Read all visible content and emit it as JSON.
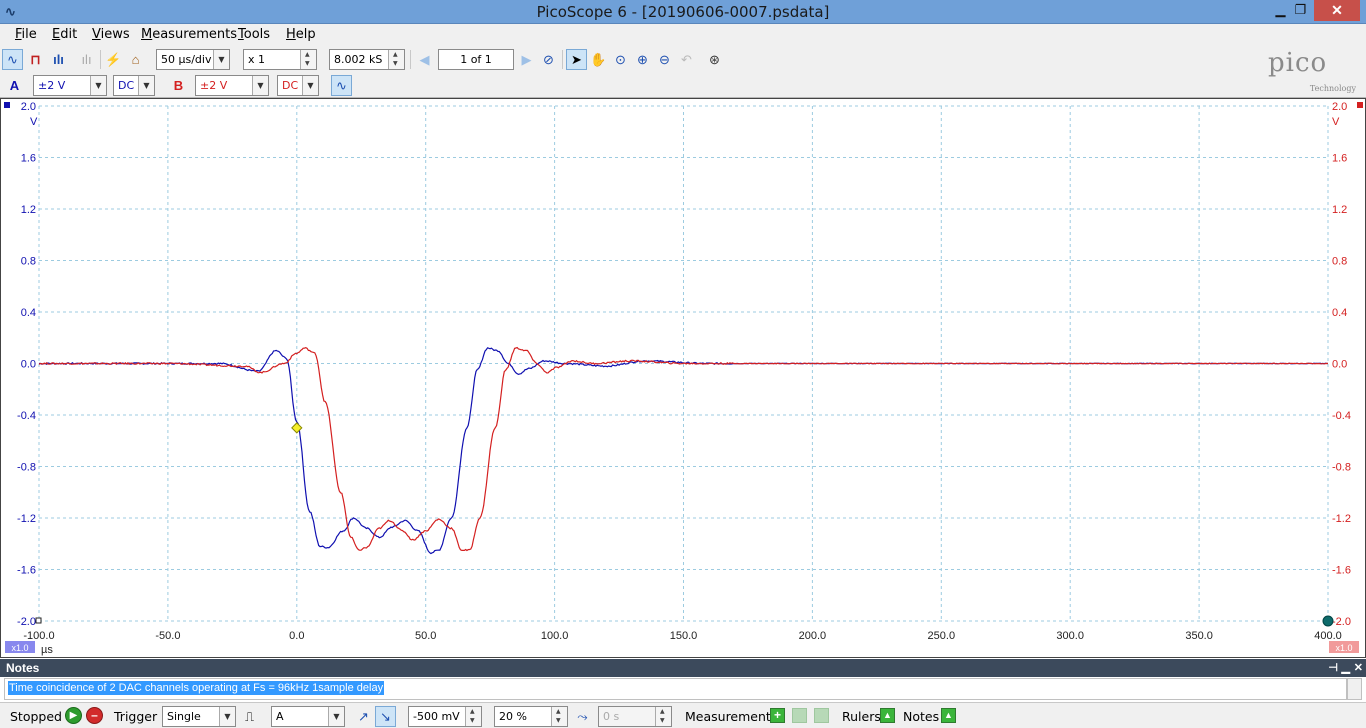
{
  "window": {
    "title": "PicoScope 6 - [20190606-0007.psdata]",
    "minimize": "▁",
    "restore": "❐",
    "close": "✕"
  },
  "menu": [
    {
      "label": "File",
      "u": "F",
      "rest": "ile"
    },
    {
      "label": "Edit",
      "u": "E",
      "rest": "dit"
    },
    {
      "label": "Views",
      "u": "V",
      "rest": "iews"
    },
    {
      "label": "Measurements",
      "u": "M",
      "rest": "easurements"
    },
    {
      "label": "Tools",
      "u": "T",
      "rest": "ools"
    },
    {
      "label": "Help",
      "u": "H",
      "rest": "elp"
    }
  ],
  "toolbar": {
    "timebase": "50 µs/div",
    "zoom": "x 1",
    "samples": "8.002 kS",
    "page": "1 of 1"
  },
  "channels": {
    "a": {
      "letter": "A",
      "range": "±2 V",
      "coupling": "DC",
      "color": "#1010b0"
    },
    "b": {
      "letter": "B",
      "range": "±2 V",
      "coupling": "DC",
      "color": "#d42020"
    }
  },
  "logo": {
    "text": "pico",
    "sub": "Technology"
  },
  "scope": {
    "y_unit": "V",
    "x_unit": "µs",
    "left_scale": "x1.0",
    "right_scale": "x1.0",
    "y_ticks": [
      "2.0",
      "1.6",
      "1.2",
      "0.8",
      "0.4",
      "0.0",
      "-0.4",
      "-0.8",
      "-1.2",
      "-1.6",
      "-2.0"
    ],
    "x_ticks": [
      "-100.0",
      "-50.0",
      "0.0",
      "50.0",
      "100.0",
      "150.0",
      "200.0",
      "250.0",
      "300.0",
      "350.0",
      "400.0"
    ],
    "trigger_marker": {
      "x": 0,
      "y": -0.5
    }
  },
  "chart_data": {
    "type": "line",
    "x_range": [
      -100,
      400
    ],
    "y_range": [
      -2.0,
      2.0
    ],
    "xlabel": "µs",
    "ylabel": "V",
    "series": [
      {
        "name": "A",
        "color": "#1010b0",
        "points": [
          [
            -100,
            0
          ],
          [
            -60,
            0
          ],
          [
            -30,
            0.0
          ],
          [
            -15,
            -0.06
          ],
          [
            -8,
            0.1
          ],
          [
            -4,
            0.04
          ],
          [
            0,
            -0.45
          ],
          [
            5,
            -1.15
          ],
          [
            9,
            -1.42
          ],
          [
            12,
            -1.43
          ],
          [
            18,
            -1.3
          ],
          [
            22,
            -1.2
          ],
          [
            27,
            -1.28
          ],
          [
            32,
            -1.35
          ],
          [
            37,
            -1.27
          ],
          [
            42,
            -1.22
          ],
          [
            47,
            -1.3
          ],
          [
            52,
            -1.47
          ],
          [
            55,
            -1.45
          ],
          [
            60,
            -1.2
          ],
          [
            66,
            -0.5
          ],
          [
            70,
            -0.05
          ],
          [
            74,
            0.12
          ],
          [
            78,
            0.1
          ],
          [
            82,
            0.0
          ],
          [
            86,
            -0.08
          ],
          [
            90,
            -0.04
          ],
          [
            96,
            0.02
          ],
          [
            104,
            0.0
          ],
          [
            120,
            -0.02
          ],
          [
            135,
            0.02
          ],
          [
            160,
            0.0
          ],
          [
            400,
            0
          ]
        ]
      },
      {
        "name": "B",
        "color": "#d42020",
        "points": [
          [
            -100,
            0
          ],
          [
            -50,
            0
          ],
          [
            -20,
            -0.02
          ],
          [
            -14,
            -0.07
          ],
          [
            -5,
            0.0
          ],
          [
            0,
            0.08
          ],
          [
            3,
            0.12
          ],
          [
            7,
            0.08
          ],
          [
            11,
            -0.3
          ],
          [
            17,
            -1.0
          ],
          [
            21,
            -1.35
          ],
          [
            24,
            -1.45
          ],
          [
            27,
            -1.43
          ],
          [
            32,
            -1.28
          ],
          [
            36,
            -1.22
          ],
          [
            41,
            -1.3
          ],
          [
            45,
            -1.37
          ],
          [
            50,
            -1.3
          ],
          [
            55,
            -1.21
          ],
          [
            60,
            -1.28
          ],
          [
            64,
            -1.45
          ],
          [
            67,
            -1.45
          ],
          [
            71,
            -1.2
          ],
          [
            77,
            -0.5
          ],
          [
            81,
            -0.05
          ],
          [
            85,
            0.12
          ],
          [
            89,
            0.1
          ],
          [
            93,
            0.0
          ],
          [
            97,
            -0.07
          ],
          [
            101,
            -0.03
          ],
          [
            107,
            0.02
          ],
          [
            115,
            0.0
          ],
          [
            130,
            0.02
          ],
          [
            150,
            0.0
          ],
          [
            400,
            0
          ]
        ]
      }
    ]
  },
  "notes": {
    "title": "Notes",
    "text": "Time coincidence of 2 DAC channels operating at Fs = 96kHz 1sample delay",
    "pin": "⊣",
    "min": "▁",
    "close": "✕"
  },
  "status": {
    "state": "Stopped",
    "trigger_label": "Trigger",
    "trigger_mode": "Single",
    "trigger_source": "A",
    "threshold": "-500 mV",
    "pretrigger": "20 %",
    "delay": "0 s",
    "measurements": "Measurements",
    "rulers": "Rulers",
    "notes": "Notes"
  }
}
